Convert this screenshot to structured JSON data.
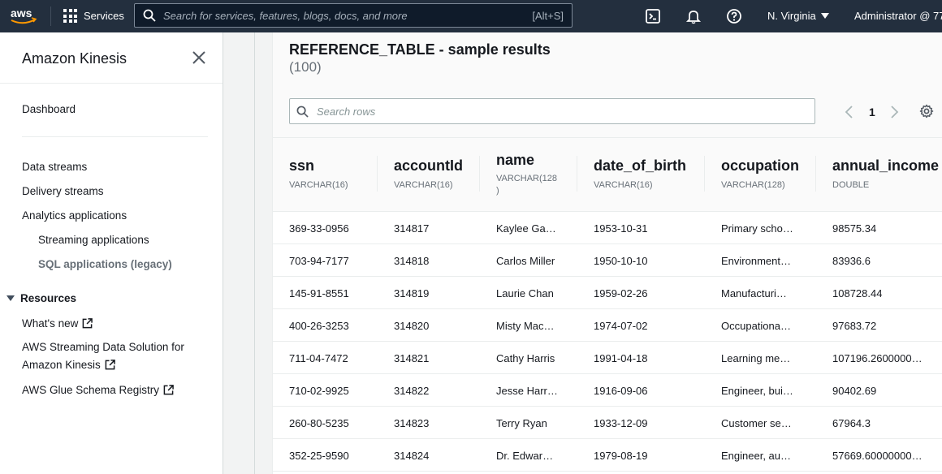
{
  "topnav": {
    "logo_text": "aws",
    "services_label": "Services",
    "search_placeholder": "Search for services, features, blogs, docs, and more",
    "search_shortcut": "[Alt+S]",
    "region": "N. Virginia",
    "account": "Administrator @ 77",
    "icons": [
      "cloudshell-icon",
      "bell-icon",
      "help-icon"
    ]
  },
  "sidebar": {
    "title": "Amazon Kinesis",
    "dashboard": "Dashboard",
    "data_streams": "Data streams",
    "delivery_streams": "Delivery streams",
    "analytics_applications": "Analytics applications",
    "streaming_applications": "Streaming applications",
    "sql_applications": "SQL applications (legacy)",
    "resources_heading": "Resources",
    "whats_new": "What's new",
    "streaming_solution_line1": "AWS Streaming Data Solution for",
    "streaming_solution_line2": "Amazon Kinesis",
    "glue_registry": "AWS Glue Schema Registry"
  },
  "panel": {
    "title": "REFERENCE_TABLE - sample results",
    "count": "(100)",
    "search_placeholder": "Search rows",
    "current_page": "1"
  },
  "table": {
    "columns": [
      {
        "name": "ssn",
        "type": "VARCHAR(16)"
      },
      {
        "name": "accountId",
        "type": "VARCHAR(16)"
      },
      {
        "name": "name",
        "type": "VARCHAR(128",
        "type_cont": ")"
      },
      {
        "name": "date_of_birth",
        "type": "VARCHAR(16)"
      },
      {
        "name": "occupation",
        "type": "VARCHAR(128)"
      },
      {
        "name": "annual_income",
        "type": "DOUBLE"
      }
    ],
    "rows": [
      [
        "369-33-0956",
        "314817",
        "Kaylee Ga…",
        "1953-10-31",
        "Primary scho…",
        "98575.34"
      ],
      [
        "703-94-7177",
        "314818",
        "Carlos Miller",
        "1950-10-10",
        "Environment…",
        "83936.6"
      ],
      [
        "145-91-8551",
        "314819",
        "Laurie Chan",
        "1959-02-26",
        "Manufacturi…",
        "108728.44"
      ],
      [
        "400-26-3253",
        "314820",
        "Misty Mac…",
        "1974-07-02",
        "Occupationa…",
        "97683.72"
      ],
      [
        "711-04-7472",
        "314821",
        "Cathy Harris",
        "1991-04-18",
        "Learning me…",
        "107196.2600000…"
      ],
      [
        "710-02-9925",
        "314822",
        "Jesse Harr…",
        "1916-09-06",
        "Engineer, bui…",
        "90402.69"
      ],
      [
        "260-80-5235",
        "314823",
        "Terry Ryan",
        "1933-12-09",
        "Customer se…",
        "67964.3"
      ],
      [
        "352-25-9590",
        "314824",
        "Dr. Edwar…",
        "1979-08-19",
        "Engineer, au…",
        "57669.60000000…"
      ]
    ]
  },
  "colors": {
    "topnav_bg": "#232f3e",
    "accent_orange": "#ff9900"
  }
}
